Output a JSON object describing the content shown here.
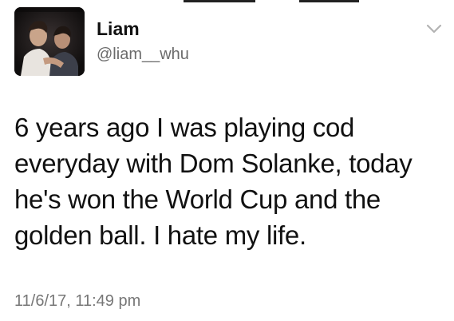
{
  "tweet": {
    "display_name": "Liam",
    "handle": "@liam__whu",
    "text_lines": [
      "6 years ago I was playing cod",
      "everyday with Dom Solanke, today",
      "he's won the World Cup and the",
      "golden ball. I hate my life."
    ],
    "timestamp": "11/6/17, 11:49 pm"
  },
  "icons": {
    "menu": "chevron-down-icon"
  },
  "colors": {
    "name": "#111111",
    "handle": "#6b6b6b",
    "timestamp": "#777777",
    "chevron": "#b3b3b3"
  }
}
